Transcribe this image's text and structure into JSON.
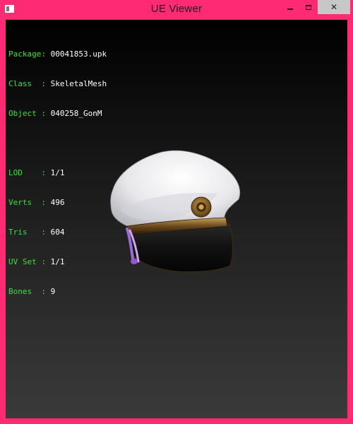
{
  "window": {
    "title": "UE Viewer",
    "icon": "app-window-icon",
    "controls": {
      "minimize_icon": "minimize-icon",
      "maximize_icon": "maximize-icon",
      "close_label": "✕"
    }
  },
  "info": {
    "package": {
      "label": "Package:",
      "value": "00041853.upk"
    },
    "class": {
      "label": "Class  :",
      "value": "SkeletalMesh"
    },
    "object": {
      "label": "Object :",
      "value": "040258_GonM"
    },
    "lod": {
      "label": "LOD    :",
      "value": "1/1"
    },
    "verts": {
      "label": "Verts  :",
      "value": "496"
    },
    "tris": {
      "label": "Tris   :",
      "value": "604"
    },
    "uvset": {
      "label": "UV Set :",
      "value": "1/1"
    },
    "bones": {
      "label": "Bones  :",
      "value": "9"
    }
  },
  "colors": {
    "window_frame": "#ff2a74",
    "label_text": "#39e339",
    "value_text": "#ffffff",
    "close_button": "#c7c7c7"
  },
  "model": {
    "name": "captain-hat-mesh",
    "depicts": "white peaked captain cap with gold badge and purple tassel"
  }
}
